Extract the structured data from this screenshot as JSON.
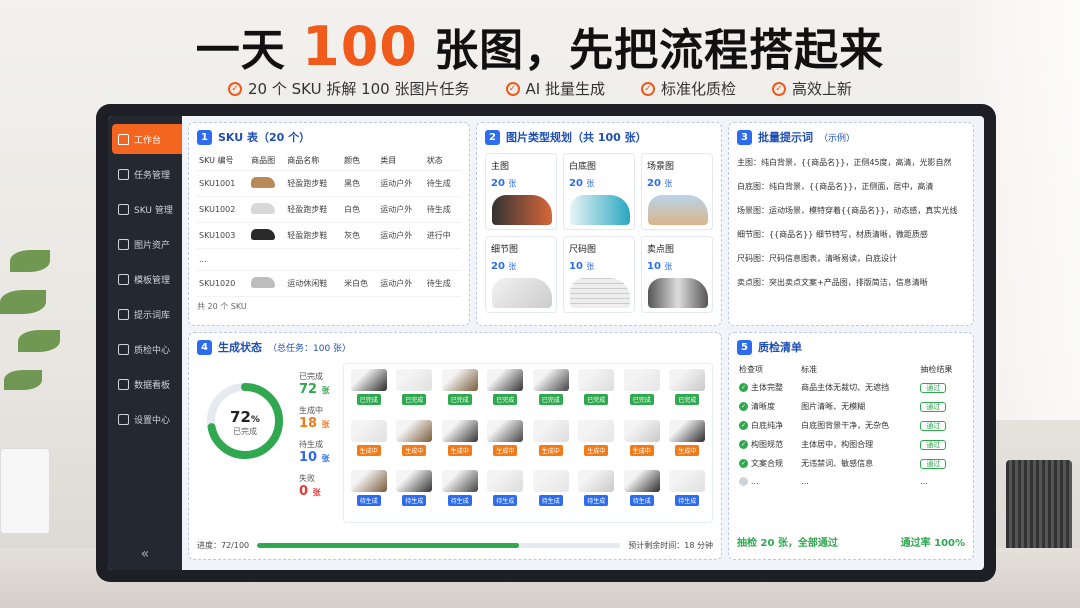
{
  "headline": {
    "pre": "一天 ",
    "highlight": "100",
    "post": " 张图，先把流程搭起来"
  },
  "sub_items": [
    "20 个 SKU 拆解 100 张图片任务",
    "AI 批量生成",
    "标准化质检",
    "高效上新"
  ],
  "sidebar": {
    "items": [
      "工作台",
      "任务管理",
      "SKU 管理",
      "图片资产",
      "模板管理",
      "提示词库",
      "质检中心",
      "数据看板",
      "设置中心"
    ],
    "collapse": "«"
  },
  "sku_panel": {
    "num": "1",
    "title": "SKU 表（20 个）",
    "headers": [
      "SKU 编号",
      "商品图",
      "商品名称",
      "颜色",
      "类目",
      "状态"
    ],
    "rows": [
      {
        "id": "SKU1001",
        "name": "轻盈跑步鞋",
        "color": "黑色",
        "cat": "运动户外",
        "status": "待生成",
        "tone": "blue",
        "shoe": "#b98a5a"
      },
      {
        "id": "SKU1002",
        "name": "轻盈跑步鞋",
        "color": "白色",
        "cat": "运动户外",
        "status": "待生成",
        "tone": "blue",
        "shoe": "#d8d8d8"
      },
      {
        "id": "SKU1003",
        "name": "轻盈跑步鞋",
        "color": "灰色",
        "cat": "运动户外",
        "status": "进行中",
        "tone": "orange",
        "shoe": "#2a2a2a"
      },
      {
        "id": "...",
        "name": "",
        "color": "",
        "cat": "",
        "status": "",
        "tone": "blue",
        "shoe": ""
      },
      {
        "id": "SKU1020",
        "name": "运动休闲鞋",
        "color": "米白色",
        "cat": "运动户外",
        "status": "待生成",
        "tone": "blue",
        "shoe": "#bdbdbd"
      }
    ],
    "footer": "共 20 个 SKU"
  },
  "type_panel": {
    "num": "2",
    "title": "图片类型规划（共 100 张）",
    "unit": "张",
    "types": [
      {
        "name": "主图",
        "count": "20"
      },
      {
        "name": "白底图",
        "count": "20"
      },
      {
        "name": "场景图",
        "count": "20"
      },
      {
        "name": "细节图",
        "count": "20"
      },
      {
        "name": "尺码图",
        "count": "10"
      },
      {
        "name": "卖点图",
        "count": "10"
      }
    ]
  },
  "prompt_panel": {
    "num": "3",
    "title": "批量提示词",
    "tag": "（示例）",
    "lines": [
      "主图：纯白背景，{{商品名}}，正侧45度，高清，光影自然",
      "白底图：纯白背景，{{商品名}}，正侧面，居中，高清",
      "场景图：运动场景，模特穿着{{商品名}}，动态感，真实光线",
      "细节图：{{商品名}} 细节特写，材质清晰，微距质感",
      "尺码图：尺码信息图表，清晰易读，白底设计",
      "卖点图：突出卖点文案+产品图，排版简洁，信息清晰"
    ]
  },
  "status_panel": {
    "num": "4",
    "title": "生成状态",
    "subtitle": "（总任务：100 张）",
    "ring_value": "72",
    "ring_unit": "%",
    "ring_label": "已完成",
    "ring_fraction": 0.72,
    "unit": "张",
    "stats": [
      {
        "label": "已完成",
        "value": "72",
        "color": "#2fa84f"
      },
      {
        "label": "生成中",
        "value": "18",
        "color": "#f07b1a"
      },
      {
        "label": "待生成",
        "value": "10",
        "color": "#2d6cf0"
      },
      {
        "label": "失败",
        "value": "0",
        "color": "#e53935"
      }
    ],
    "rows": [
      {
        "tag": "已完成",
        "cls": "done",
        "count": 8
      },
      {
        "tag": "生成中",
        "cls": "ing",
        "count": 8
      },
      {
        "tag": "待生成",
        "cls": "wait",
        "count": 8
      }
    ],
    "progress_label": "进度：72/100",
    "progress_fraction": 0.72,
    "eta": "预计剩余时间：18 分钟"
  },
  "qc_panel": {
    "num": "5",
    "title": "质检清单",
    "headers": [
      "检查项",
      "标准",
      "抽检结果"
    ],
    "rows": [
      {
        "item": "主体完整",
        "std": "商品主体无裁切、无遮挡",
        "result": "通过"
      },
      {
        "item": "清晰度",
        "std": "图片清晰、无模糊",
        "result": "通过"
      },
      {
        "item": "白底纯净",
        "std": "白底图背景干净，无杂色",
        "result": "通过"
      },
      {
        "item": "构图规范",
        "std": "主体居中，构图合理",
        "result": "通过"
      },
      {
        "item": "文案合规",
        "std": "无违禁词、敏感信息",
        "result": "通过"
      },
      {
        "item": "...",
        "std": "...",
        "result": "..."
      }
    ],
    "footer_left": "抽检 20 张，全部通过",
    "footer_right": "通过率 100%"
  },
  "colors": {
    "accent": "#f05a1a",
    "primary": "#2d6cf0",
    "success": "#2fa84f",
    "warning": "#f07b1a"
  }
}
